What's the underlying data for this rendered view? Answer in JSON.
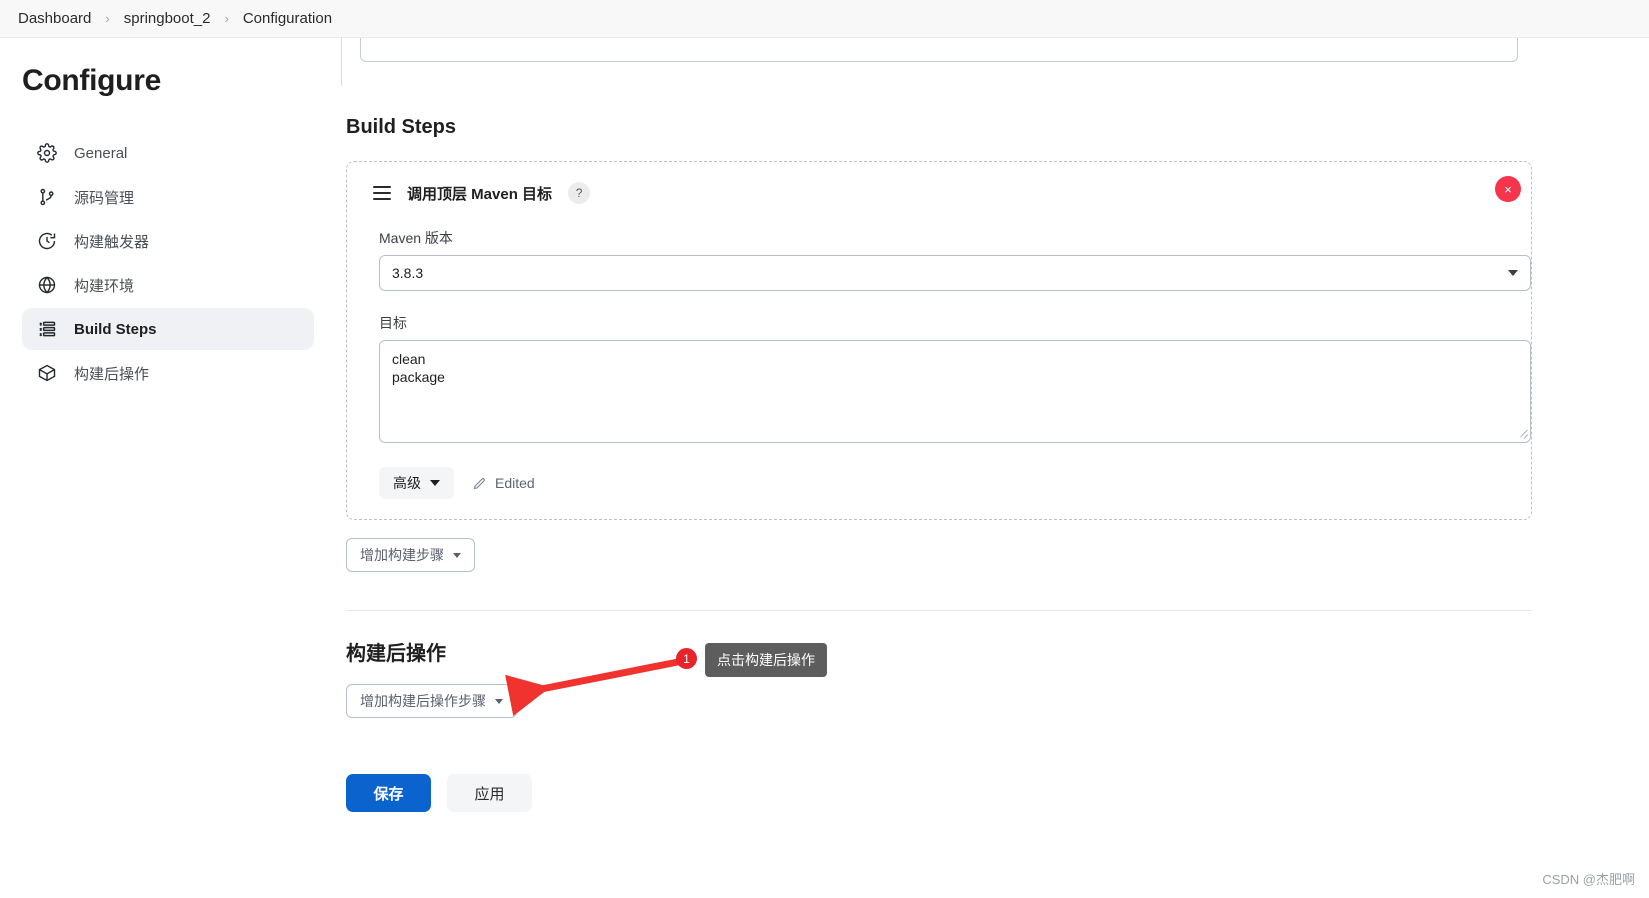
{
  "breadcrumb": {
    "items": [
      "Dashboard",
      "springboot_2",
      "Configuration"
    ],
    "separator": "›"
  },
  "sidebar": {
    "title": "Configure",
    "items": [
      {
        "label": "General",
        "icon": "gear-icon",
        "active": false
      },
      {
        "label": "源码管理",
        "icon": "branch-icon",
        "active": false
      },
      {
        "label": "构建触发器",
        "icon": "clock-icon",
        "active": false
      },
      {
        "label": "构建环境",
        "icon": "globe-icon",
        "active": false
      },
      {
        "label": "Build Steps",
        "icon": "list-icon",
        "active": true
      },
      {
        "label": "构建后操作",
        "icon": "package-icon",
        "active": false
      }
    ]
  },
  "main": {
    "build_steps_heading": "Build Steps",
    "step": {
      "title": "调用顶层 Maven 目标",
      "help_label": "?",
      "delete_label": "×",
      "maven_version_label": "Maven 版本",
      "maven_version_value": "3.8.3",
      "goals_label": "目标",
      "goals_value": "clean\npackage",
      "advanced_label": "高级",
      "edited_label": "Edited"
    },
    "add_build_step_label": "增加构建步骤",
    "post_build_heading": "构建后操作",
    "add_post_build_step_label": "增加构建后操作步骤",
    "save_label": "保存",
    "apply_label": "应用"
  },
  "annotation": {
    "badge_number": "1",
    "callout_text": "点击构建后操作"
  },
  "watermark": "CSDN @杰肥啊",
  "colors": {
    "primary": "#0b63ce",
    "danger": "#f4354b",
    "annotation_red": "#e8242b",
    "callout_bg": "#5d5d5d"
  }
}
